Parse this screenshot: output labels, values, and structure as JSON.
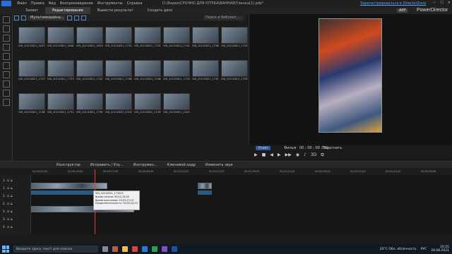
{
  "menu": [
    "Файл",
    "Правка",
    "Вид",
    "Воспроизведение",
    "Инструменты",
    "Справка"
  ],
  "window_title": "D:\\Видео\\СРОЧНО ДЛЯ ЮТУБА\\ВАННАЯ\\Тлинка(1).pds*",
  "register_link": "Зарегистрироваться в DirectorZone",
  "mode_tabs": {
    "capture": "Захват",
    "edit": "Редактирование",
    "produce": "Вывести результат",
    "disc": "Создать диск"
  },
  "app_badge": "APP",
  "brand": "PowerDirector",
  "library": {
    "filter": "Мультимедийна...",
    "search_placeholder": "Поиск в библиот...",
    "clips": [
      "VID_20210821_16474...",
      "VID_20210821_16483...",
      "VID_20210821_16510...",
      "VID_20210821_17322...",
      "VID_20210821_17323...",
      "VID_20210821_17323...",
      "VID_20210821_17580...",
      "VID_20210821_17334...",
      "VID_20210821_17375...",
      "VID_20210821_17376...",
      "VID_20210821_17427...",
      "VID_20210821_17462...",
      "VID_20210821_17484...",
      "VID_20210821_17534...",
      "VID_20210821_17491...",
      "VID_20210821_17555...",
      "VID_20210821_11985...",
      "VID_20210821_17914...",
      "VID_20210821_17905...",
      "VID_20210822_09145...",
      "VID_20210822_11593...",
      "VID_20210821_14103..."
    ]
  },
  "preview": {
    "clip_tab": "Клип",
    "film_tab": "Фильм",
    "timecode": "00 ; 00 ; 00 ; 00",
    "quality": "Подогнать"
  },
  "edit_toolbar": [
    "Конструктор",
    "Исправить / Улу...",
    "Инструмен...",
    "Ключевой кадр",
    "Изменить звук"
  ],
  "ruler_ticks": [
    "00;00;00;00",
    "00;00;16;00",
    "00;00;32;00",
    "00;00;48;00",
    "00;01;04;02",
    "00;01;20;02",
    "00;01;36;02",
    "00;01;52;04",
    "00;02;08;04",
    "00;02;24;04",
    "00;02;40;04",
    "00;02;56;06"
  ],
  "track_labels": [
    "1.",
    "1.",
    "2.",
    "2.",
    "3.",
    "3.",
    "4."
  ],
  "tooltip": {
    "name": "VID_20210821_173023",
    "start": "Время начала: 00;01;13;00",
    "end": "Время окончания: 00;01;27;15",
    "duration": "Продолжительность: 00;00;14;15"
  },
  "taskbar": {
    "search_placeholder": "Введите здесь текст для поиска",
    "weather": "20°С Обл. облачность",
    "time": "20:25",
    "date": "28.08.2021",
    "lang": "РУС"
  }
}
